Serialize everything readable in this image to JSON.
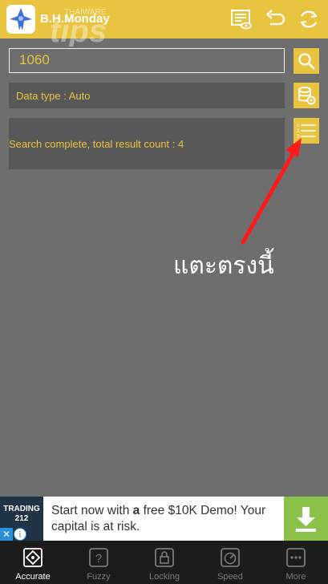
{
  "header": {
    "app_title": "B.H.Monday",
    "watermark_text": "tips",
    "watermark_brand": "THAIWARE"
  },
  "search": {
    "value": "1060"
  },
  "data_type": {
    "label": "Data type :  Auto"
  },
  "result": {
    "status": "Search complete, total result count : 4"
  },
  "annotation": {
    "text": "แตะตรงนี้"
  },
  "ad": {
    "brand_line1": "TRADING",
    "brand_line2": "212",
    "text_prefix": "Start now with ",
    "text_bold": "a",
    "text_suffix": " free $10K Demo! Your capital is at risk.",
    "close_glyph": "✕",
    "info_glyph": "i"
  },
  "tabs": [
    {
      "label": "Accurate",
      "icon": "crosshair-icon",
      "active": true
    },
    {
      "label": "Fuzzy",
      "icon": "question-icon",
      "active": false
    },
    {
      "label": "Locking",
      "icon": "lock-icon",
      "active": false
    },
    {
      "label": "Speed",
      "icon": "speedometer-icon",
      "active": false
    },
    {
      "label": "More",
      "icon": "more-icon",
      "active": false
    }
  ],
  "colors": {
    "accent": "#e8c440",
    "background": "#6e6e6e",
    "panel": "#585858",
    "tabbar": "#1c1c1c",
    "annotation_arrow": "#ff1a1a",
    "ad_download": "#8bc34a"
  }
}
